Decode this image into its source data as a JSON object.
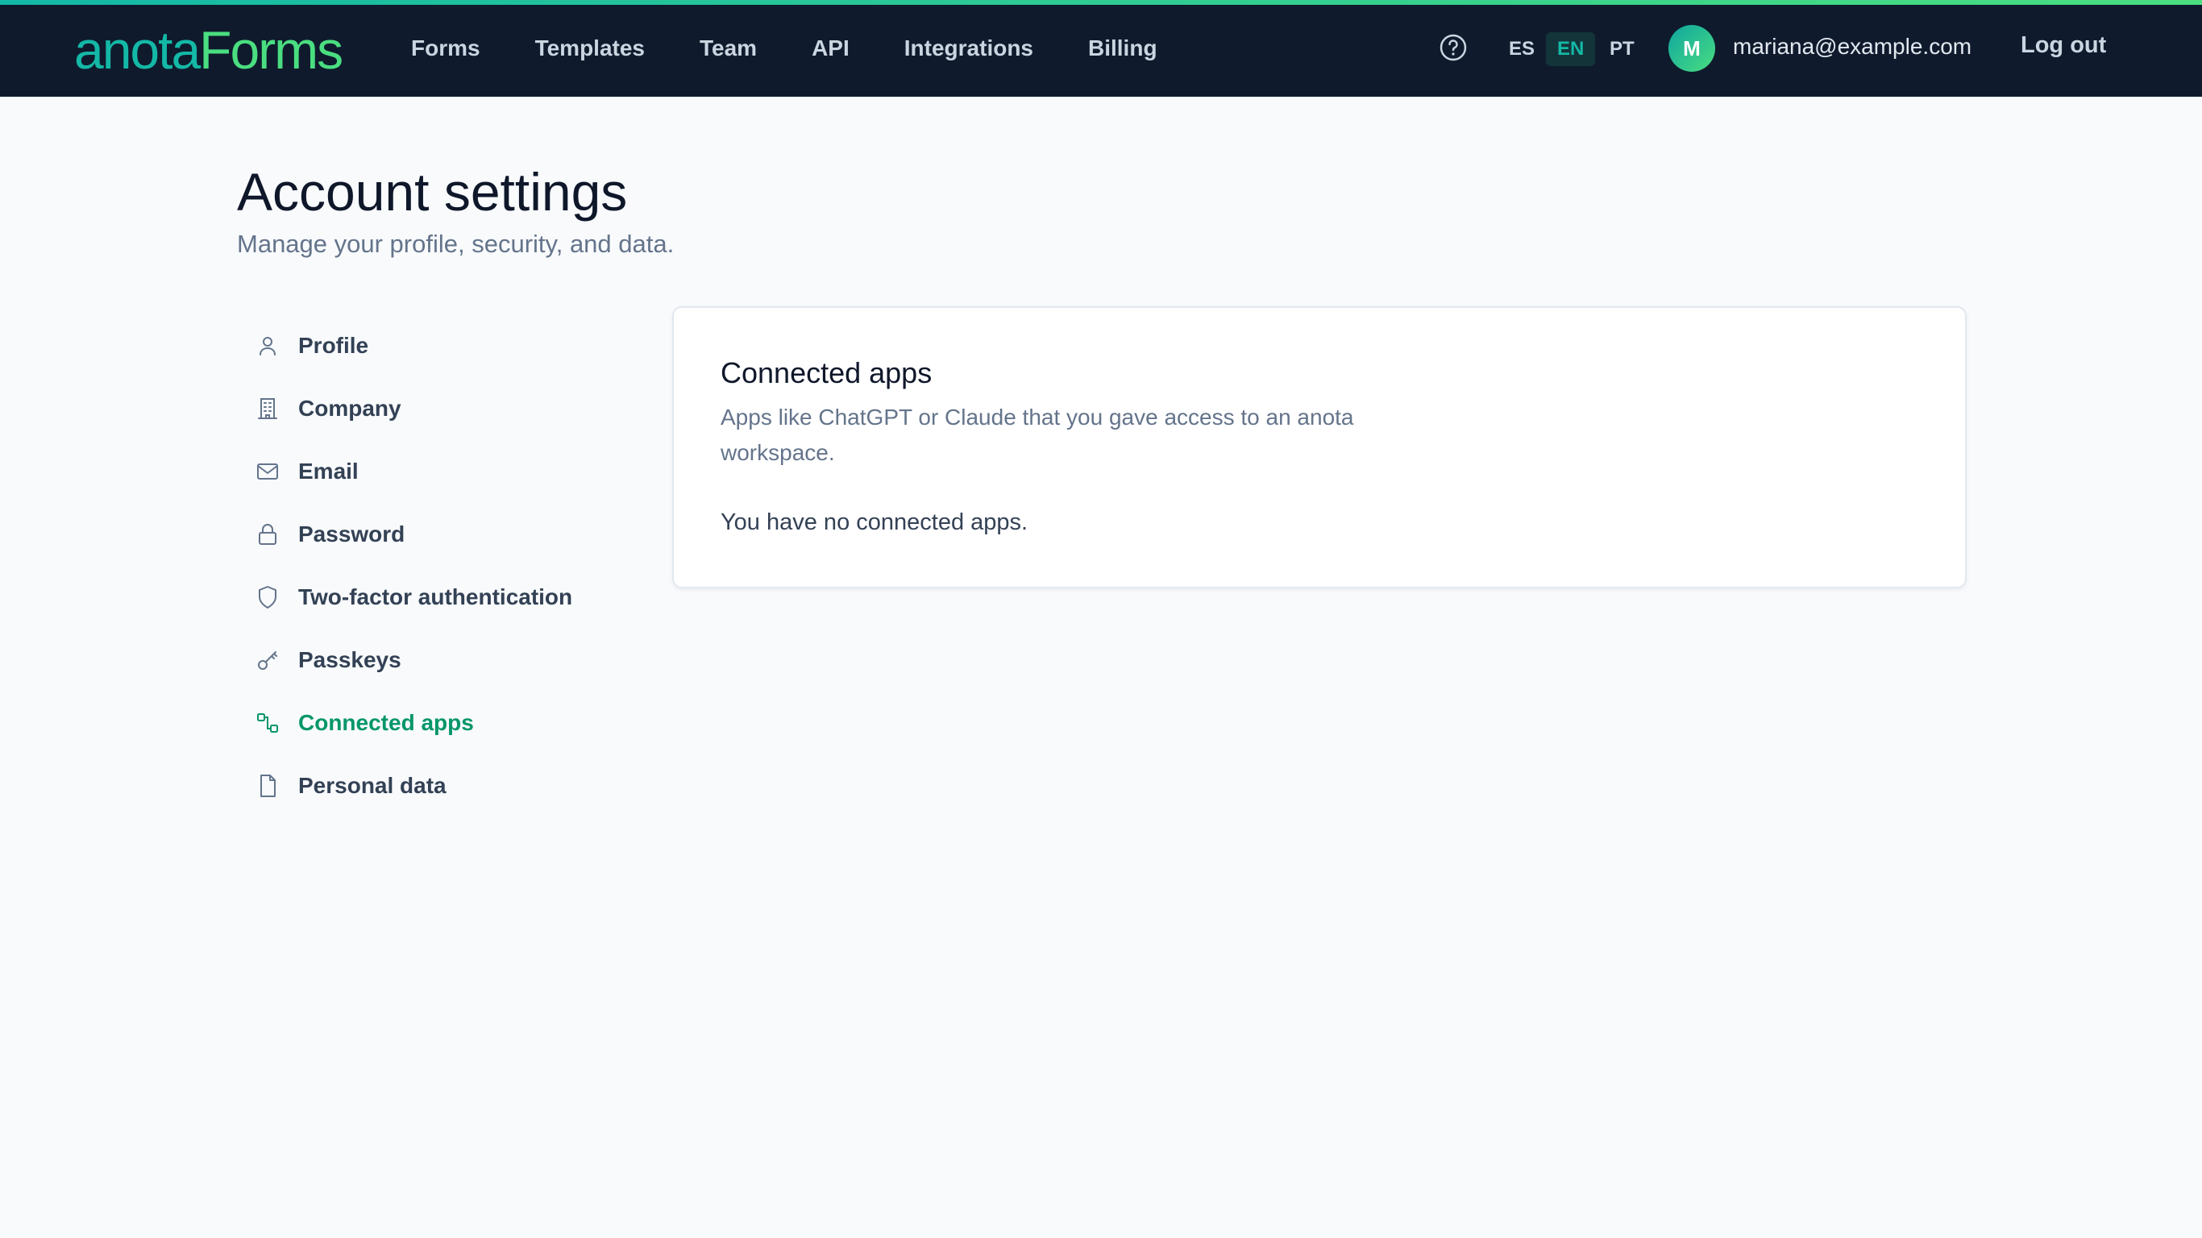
{
  "brand": {
    "part1": "anota",
    "part2": "Forms"
  },
  "nav": [
    "Forms",
    "Templates",
    "Team",
    "API",
    "Integrations",
    "Billing"
  ],
  "languages": [
    "ES",
    "EN",
    "PT"
  ],
  "active_language": "EN",
  "user": {
    "initial": "M",
    "email": "mariana@example.com"
  },
  "logout_label": "Log out",
  "page": {
    "title": "Account settings",
    "subtitle": "Manage your profile, security, and data."
  },
  "sidebar": {
    "items": [
      {
        "label": "Profile",
        "icon": "user-icon"
      },
      {
        "label": "Company",
        "icon": "building-icon"
      },
      {
        "label": "Email",
        "icon": "mail-icon"
      },
      {
        "label": "Password",
        "icon": "lock-icon"
      },
      {
        "label": "Two-factor authentication",
        "icon": "shield-icon"
      },
      {
        "label": "Passkeys",
        "icon": "key-icon"
      },
      {
        "label": "Connected apps",
        "icon": "connected-apps-icon"
      },
      {
        "label": "Personal data",
        "icon": "file-icon"
      }
    ],
    "active": "Connected apps"
  },
  "card": {
    "title": "Connected apps",
    "description": "Apps like ChatGPT or Claude that you gave access to an anota workspace.",
    "empty_message": "You have no connected apps."
  },
  "colors": {
    "accent": "#059669",
    "topbar": "#0f1b2d",
    "brand_teal": "#14b8a6",
    "brand_green": "#4ade80"
  }
}
